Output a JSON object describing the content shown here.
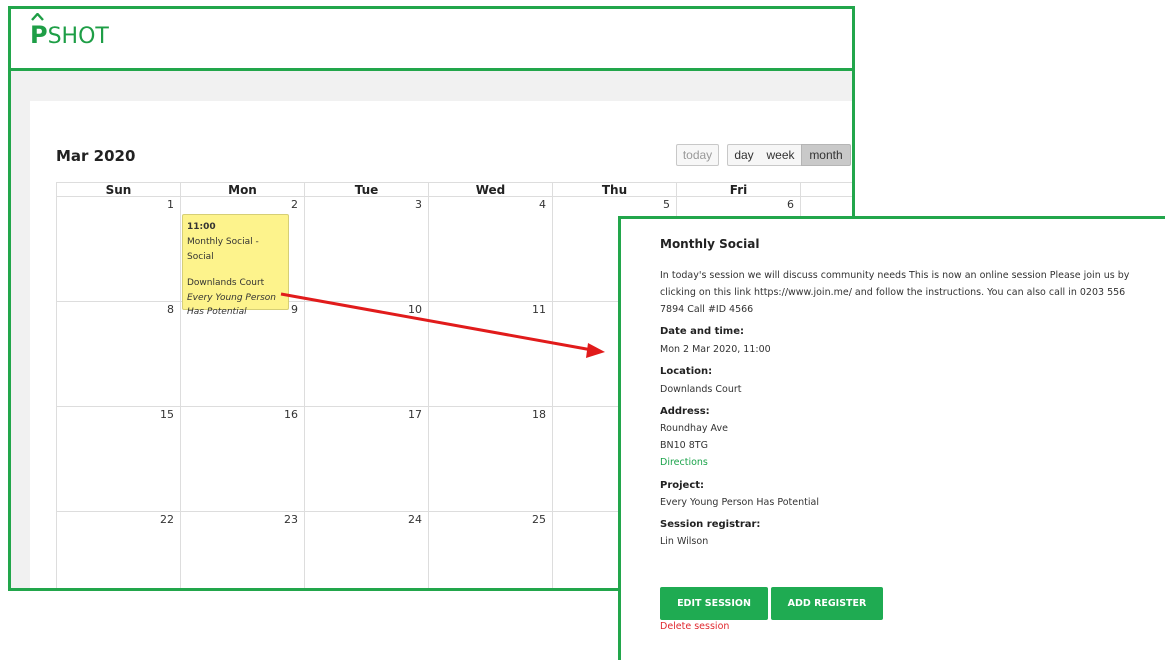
{
  "app": {
    "logo_mark": "Û",
    "logo_p": "P",
    "logo_rest": "SHOT"
  },
  "calendar": {
    "title": "Mar 2020",
    "buttons": {
      "today": "today",
      "day": "day",
      "week": "week",
      "month": "month"
    },
    "weekdays": [
      "Sun",
      "Mon",
      "Tue",
      "Wed",
      "Thu",
      "Fri"
    ],
    "weeks": [
      [
        "1",
        "2",
        "3",
        "4",
        "5",
        "6"
      ],
      [
        "8",
        "9",
        "10",
        "11",
        "",
        ""
      ],
      [
        "15",
        "16",
        "17",
        "18",
        "",
        ""
      ],
      [
        "22",
        "23",
        "24",
        "25",
        "",
        ""
      ]
    ],
    "event": {
      "time": "11:00",
      "name": "Monthly Social - Social",
      "location": "Downlands Court",
      "project": "Every Young Person Has Potential"
    }
  },
  "popup": {
    "title": "Monthly Social",
    "description": "In today's session we will discuss community needs This is now an online session Please join us by clicking on this link https://www.join.me/ and follow the instructions. You can also call in 0203 556 7894 Call #ID 4566",
    "date_label": "Date and time:",
    "date_value": "Mon 2 Mar 2020, 11:00",
    "location_label": "Location:",
    "location_value": "Downlands Court",
    "address_label": "Address:",
    "address_line1": "Roundhay Ave",
    "address_line2": "BN10 8TG",
    "directions": "Directions",
    "project_label": "Project:",
    "project_value": "Every Young Person Has Potential",
    "registrar_label": "Session registrar:",
    "registrar_value": "Lin Wilson",
    "edit_button": "EDIT SESSION",
    "add_button": "ADD REGISTER",
    "delete_link": "Delete session"
  },
  "colors": {
    "brand_green": "#22a64b",
    "event_yellow": "#fdf38c",
    "arrow_red": "#e11b1b",
    "delete_red": "#e0282e"
  }
}
